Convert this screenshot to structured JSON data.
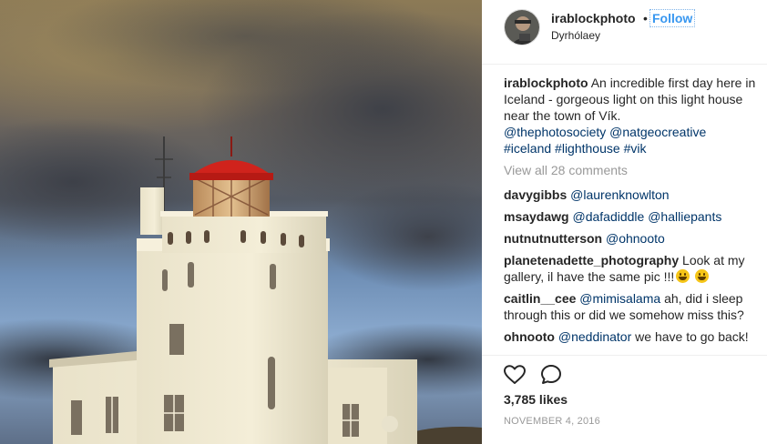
{
  "post": {
    "image_alt": "Lighthouse at Dyrhólaey under dark clouds",
    "header": {
      "username": "irablockphoto",
      "separator": "•",
      "follow_label": "Follow",
      "location": "Dyrhólaey"
    },
    "caption": {
      "username": "irablockphoto",
      "text": "An incredible first day here in Iceland - gorgeous light on this light house near the town of Vík.",
      "mentions": [
        "@thephotosociety",
        "@natgeocreative"
      ],
      "hashtags": [
        "#iceland",
        "#lighthouse",
        "#vik"
      ]
    },
    "view_all_comments": "View all 28 comments",
    "comments": [
      {
        "username": "davygibbs",
        "text": "@laurenknowlton"
      },
      {
        "username": "msaydawg",
        "text": "@dafadiddle @halliepants"
      },
      {
        "username": "nutnutnutterson",
        "text": "@ohnooto"
      },
      {
        "username": "planetenadette_photography",
        "text": "Look at my gallery, il have the same pic !!!",
        "emoji_count": 2,
        "emoji_icon": "grinning-face-emoji"
      },
      {
        "username": "caitlin__cee",
        "mention": "@mimisalama",
        "text": "ah, did i sleep through this or did we somehow miss this?"
      },
      {
        "username": "ohnooto",
        "mention": "@neddinator",
        "text": "we have to go back!"
      }
    ],
    "actions": {
      "like_icon": "heart-icon",
      "comment_icon": "comment-icon"
    },
    "likes": "3,785 likes",
    "date": "NOVEMBER 4, 2016"
  },
  "colors": {
    "link_blue": "#3897f0",
    "tag_navy": "#003569",
    "muted_gray": "#999999",
    "text_dark": "#262626",
    "lighthouse_red": "#d0231c"
  }
}
